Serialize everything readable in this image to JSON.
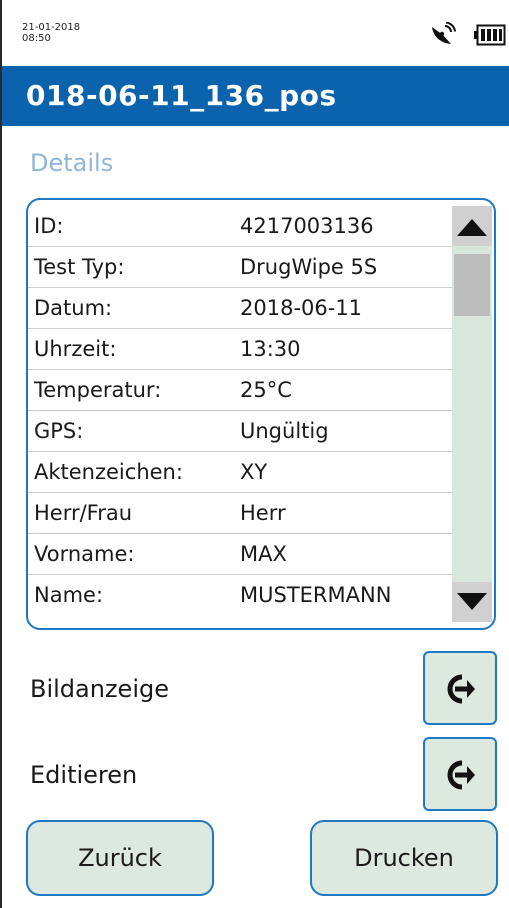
{
  "status": {
    "date": "21-01-2018",
    "time": "08:50",
    "icons": [
      "satellite-icon",
      "battery-icon"
    ]
  },
  "header": {
    "title": "018-06-11_136_pos"
  },
  "section": {
    "title": "Details"
  },
  "details": [
    {
      "label": "ID:",
      "value": "4217003136"
    },
    {
      "label": "Test Typ:",
      "value": "DrugWipe 5S"
    },
    {
      "label": "Datum:",
      "value": "2018-06-11"
    },
    {
      "label": "Uhrzeit:",
      "value": "13:30"
    },
    {
      "label": "Temperatur:",
      "value": "25°C"
    },
    {
      "label": "GPS:",
      "value": "Ungültig"
    },
    {
      "label": "Aktenzeichen:",
      "value": "XY"
    },
    {
      "label": "Herr/Frau",
      "value": "Herr"
    },
    {
      "label": "Vorname:",
      "value": "MAX"
    },
    {
      "label": "Name:",
      "value": "MUSTERMANN"
    }
  ],
  "actions": [
    {
      "label": "Bildanzeige",
      "icon": "arrow-right-circle-icon"
    },
    {
      "label": "Editieren",
      "icon": "arrow-right-circle-icon"
    }
  ],
  "buttons": {
    "back": "Zurück",
    "print": "Drucken"
  },
  "colors": {
    "header_bg": "#0c63ad",
    "accent": "#1e78c2",
    "button_bg": "#dde8df",
    "section_label": "#8fb5dc"
  }
}
